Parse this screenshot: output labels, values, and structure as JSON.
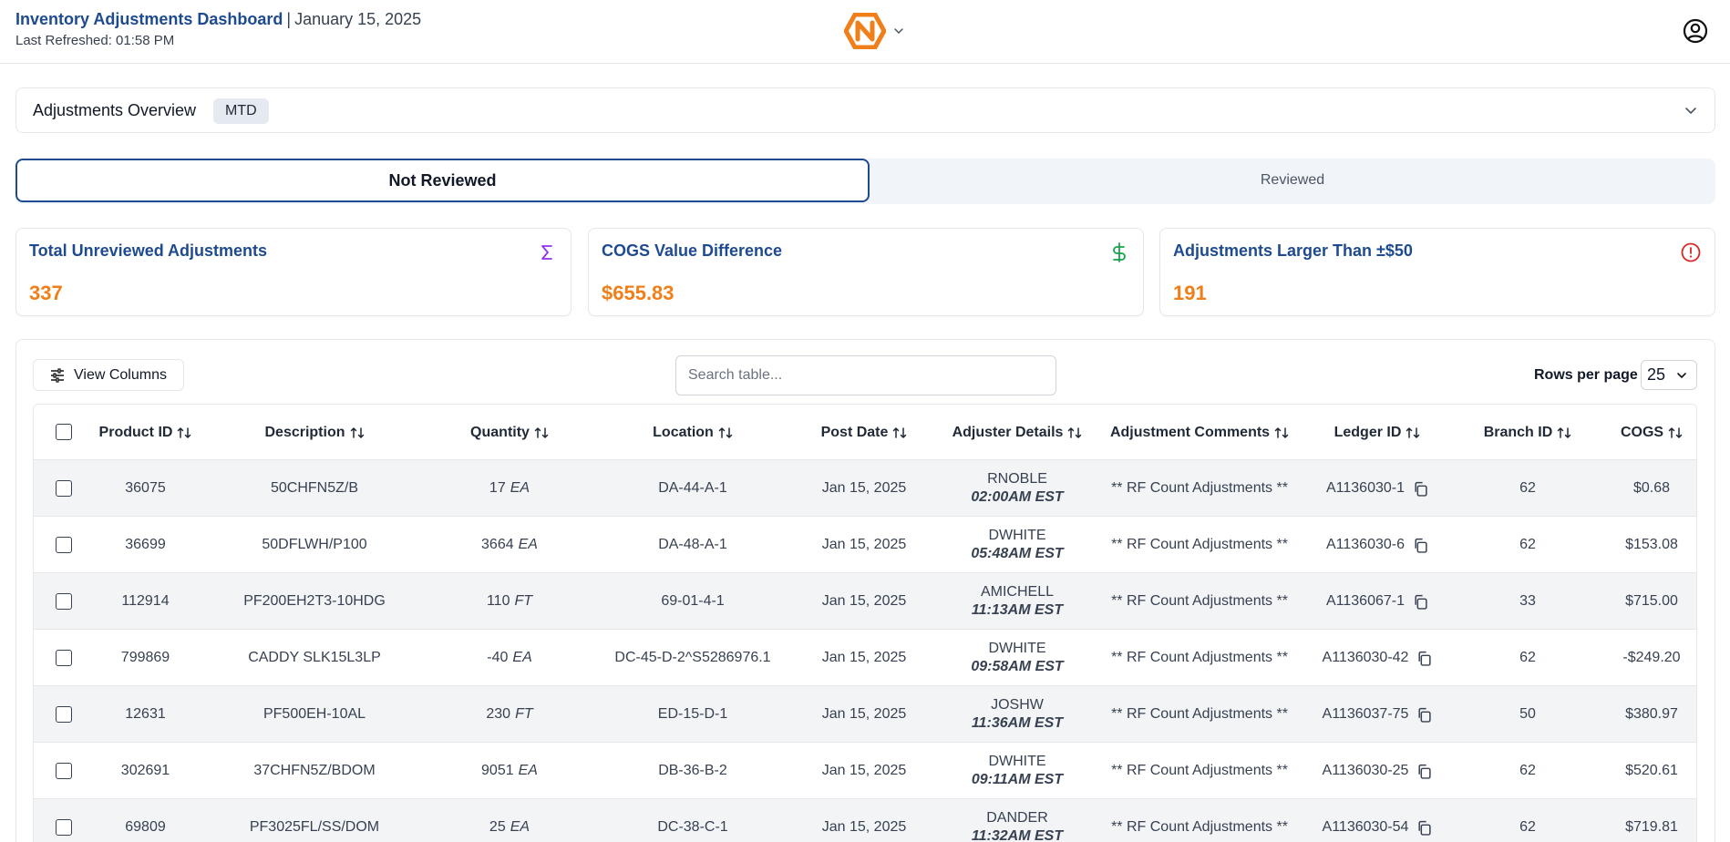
{
  "header": {
    "title": "Inventory Adjustments Dashboard",
    "separator": "|",
    "date": "January 15, 2025",
    "last_refreshed": "Last Refreshed: 01:58 PM",
    "logo_icon": "brand-n-logo-icon",
    "profile_icon": "user-circle-icon"
  },
  "overview": {
    "title": "Adjustments Overview",
    "badge": "MTD"
  },
  "tabs": {
    "active": "Not Reviewed",
    "inactive": "Reviewed"
  },
  "cards": [
    {
      "title": "Total Unreviewed Adjustments",
      "value": "337",
      "icon": "sigma-icon",
      "icon_color": "#9333ea"
    },
    {
      "title": "COGS Value Difference",
      "value": "$655.83",
      "icon": "dollar-icon",
      "icon_color": "#16a34a"
    },
    {
      "title": "Adjustments Larger Than ±$50",
      "value": "191",
      "icon": "alert-circle-icon",
      "icon_color": "#dc2626"
    }
  ],
  "toolbar": {
    "view_columns": "View Columns",
    "search_placeholder": "Search table...",
    "rows_per_page_label": "Rows per page",
    "rows_per_page_value": "25"
  },
  "columns": [
    "Product ID",
    "Description",
    "Quantity",
    "Location",
    "Post Date",
    "Adjuster Details",
    "Adjustment Comments",
    "Ledger ID",
    "Branch ID",
    "COGS"
  ],
  "rows": [
    {
      "product_id": "36075",
      "description": "50CHFN5Z/B",
      "qty": "17",
      "unit": "EA",
      "location": "DA-44-A-1",
      "post_date": "Jan 15, 2025",
      "adjuster": "RNOBLE",
      "time": "02:00AM EST",
      "comments": "** RF Count Adjustments **",
      "ledger_id": "A1136030-1",
      "branch_id": "62",
      "cogs": "$0.68"
    },
    {
      "product_id": "36699",
      "description": "50DFLWH/P100",
      "qty": "3664",
      "unit": "EA",
      "location": "DA-48-A-1",
      "post_date": "Jan 15, 2025",
      "adjuster": "DWHITE",
      "time": "05:48AM EST",
      "comments": "** RF Count Adjustments **",
      "ledger_id": "A1136030-6",
      "branch_id": "62",
      "cogs": "$153.08"
    },
    {
      "product_id": "112914",
      "description": "PF200EH2T3-10HDG",
      "qty": "110",
      "unit": "FT",
      "location": "69-01-4-1",
      "post_date": "Jan 15, 2025",
      "adjuster": "AMICHELL",
      "time": "11:13AM EST",
      "comments": "** RF Count Adjustments **",
      "ledger_id": "A1136067-1",
      "branch_id": "33",
      "cogs": "$715.00"
    },
    {
      "product_id": "799869",
      "description": "CADDY SLK15L3LP",
      "qty": "-40",
      "unit": "EA",
      "location": "DC-45-D-2^S5286976.1",
      "post_date": "Jan 15, 2025",
      "adjuster": "DWHITE",
      "time": "09:58AM EST",
      "comments": "** RF Count Adjustments **",
      "ledger_id": "A1136030-42",
      "branch_id": "62",
      "cogs": "-$249.20"
    },
    {
      "product_id": "12631",
      "description": "PF500EH-10AL",
      "qty": "230",
      "unit": "FT",
      "location": "ED-15-D-1",
      "post_date": "Jan 15, 2025",
      "adjuster": "JOSHW",
      "time": "11:36AM EST",
      "comments": "** RF Count Adjustments **",
      "ledger_id": "A1136037-75",
      "branch_id": "50",
      "cogs": "$380.97"
    },
    {
      "product_id": "302691",
      "description": "37CHFN5Z/BDOM",
      "qty": "9051",
      "unit": "EA",
      "location": "DB-36-B-2",
      "post_date": "Jan 15, 2025",
      "adjuster": "DWHITE",
      "time": "09:11AM EST",
      "comments": "** RF Count Adjustments **",
      "ledger_id": "A1136030-25",
      "branch_id": "62",
      "cogs": "$520.61"
    },
    {
      "product_id": "69809",
      "description": "PF3025FL/SS/DOM",
      "qty": "25",
      "unit": "EA",
      "location": "DC-38-C-1",
      "post_date": "Jan 15, 2025",
      "adjuster": "DANDER",
      "time": "11:32AM EST",
      "comments": "** RF Count Adjustments **",
      "ledger_id": "A1136030-54",
      "branch_id": "62",
      "cogs": "$719.81"
    }
  ]
}
